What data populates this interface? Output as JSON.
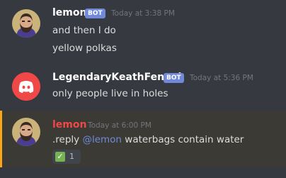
{
  "messages": [
    {
      "author": "lemon",
      "bot_tag": "BOT",
      "timestamp": "Today at 3:38 PM",
      "lines": [
        "and then I do",
        "yellow polkas"
      ]
    },
    {
      "author": "LegendaryKeathFennel",
      "bot_tag": "BOT",
      "timestamp": "Today at 5:36 PM",
      "lines": [
        "only people live in holes"
      ]
    },
    {
      "author": "lemon",
      "timestamp": "Today at 6:00 PM",
      "content_prefix": ".reply",
      "mention": "@lemon",
      "content_suffix": "waterbags contain water",
      "reaction": {
        "emoji": "✅",
        "count": "1"
      }
    }
  ],
  "colors": {
    "background": "#36393f",
    "bot_badge": "#7289da",
    "mention": "#7289da",
    "highlight_author": "#f04747",
    "highlight_border": "#faa61a",
    "discord_avatar": "#f04747"
  },
  "icons": {
    "lemon_avatar": "bearded-man-avatar-icon",
    "discord_avatar": "discord-logo-icon",
    "reaction_emoji": "white-check-mark-icon"
  }
}
